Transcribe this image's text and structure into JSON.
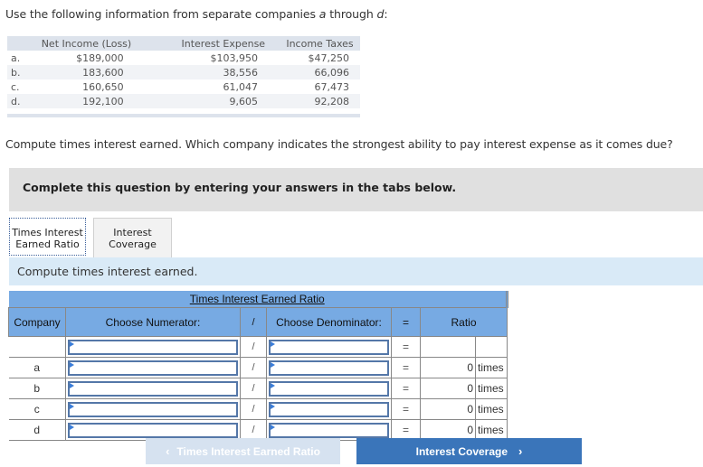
{
  "intro": {
    "prefix": "Use the following information from separate companies ",
    "a": "a",
    "through": " through ",
    "d": "d",
    "suffix": ":"
  },
  "info_table": {
    "headers": [
      "",
      "Net Income (Loss)",
      "Interest Expense",
      "Income Taxes"
    ],
    "rows": [
      {
        "label": "a.",
        "net_income": "$189,000",
        "interest_expense": "$103,950",
        "income_taxes": "$47,250"
      },
      {
        "label": "b.",
        "net_income": "183,600",
        "interest_expense": "38,556",
        "income_taxes": "66,096"
      },
      {
        "label": "c.",
        "net_income": "160,650",
        "interest_expense": "61,047",
        "income_taxes": "67,473"
      },
      {
        "label": "d.",
        "net_income": "192,100",
        "interest_expense": "9,605",
        "income_taxes": "92,208"
      }
    ]
  },
  "question": "Compute times interest earned. Which company indicates the strongest ability to pay interest expense as it comes due?",
  "complete_box": "Complete this question by entering your answers in the tabs below.",
  "tabs": [
    {
      "line1": "Times Interest",
      "line2": "Earned Ratio",
      "active": true
    },
    {
      "line1": "Interest",
      "line2": "Coverage",
      "active": false
    }
  ],
  "instruction": "Compute times interest earned.",
  "ratio_table": {
    "title": "Times Interest Earned Ratio",
    "headers": {
      "company": "Company",
      "numerator": "Choose Numerator:",
      "slash": "/",
      "denominator": "Choose Denominator:",
      "equals": "=",
      "ratio": "Ratio"
    },
    "rows": [
      {
        "company": "",
        "numerator": "",
        "slash": "/",
        "denominator": "",
        "equals": "=",
        "value": "",
        "unit": ""
      },
      {
        "company": "a",
        "numerator": "",
        "slash": "/",
        "denominator": "",
        "equals": "=",
        "value": "0",
        "unit": "times"
      },
      {
        "company": "b",
        "numerator": "",
        "slash": "/",
        "denominator": "",
        "equals": "=",
        "value": "0",
        "unit": "times"
      },
      {
        "company": "c",
        "numerator": "",
        "slash": "/",
        "denominator": "",
        "equals": "=",
        "value": "0",
        "unit": "times"
      },
      {
        "company": "d",
        "numerator": "",
        "slash": "/",
        "denominator": "",
        "equals": "=",
        "value": "0",
        "unit": "times"
      }
    ]
  },
  "nav": {
    "prev_label": "Times Interest Earned Ratio",
    "prev_icon": "chevron-left-icon",
    "next_label": "Interest Coverage",
    "next_icon": "chevron-right-icon"
  },
  "colors": {
    "table_header": "#77aae3",
    "instruction_bg": "#d9eaf7",
    "next_button": "#3a75ba",
    "prev_button_disabled": "#d6e2f0"
  }
}
